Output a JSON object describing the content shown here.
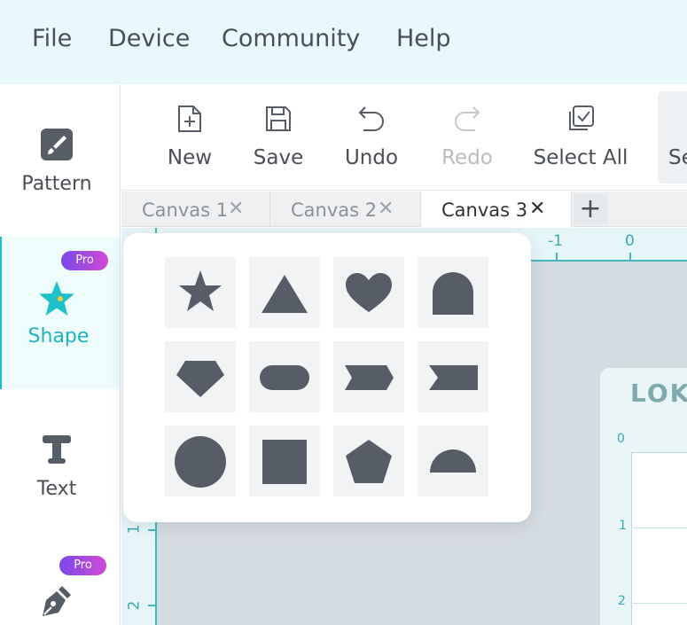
{
  "menu": {
    "file": "File",
    "device": "Device",
    "community": "Community",
    "help": "Help"
  },
  "sidebar": {
    "items": [
      {
        "label": "Pattern",
        "icon": "brush-icon"
      },
      {
        "label": "Shape",
        "icon": "star-icon",
        "badge": "Pro",
        "active": true
      },
      {
        "label": "Text",
        "icon": "text-t-icon"
      },
      {
        "label": "",
        "icon": "pen-nib-icon",
        "badge": "Pro"
      }
    ]
  },
  "toolbar": {
    "new_label": "New",
    "save_label": "Save",
    "undo_label": "Undo",
    "redo_label": "Redo",
    "select_all_label": "Select All",
    "cut_partial_label": "Se"
  },
  "tabs": [
    {
      "label": "Canvas 1",
      "close": "✕"
    },
    {
      "label": "Canvas 2",
      "close": "✕"
    },
    {
      "label": "Canvas 3",
      "close": "✕",
      "active": true
    }
  ],
  "tab_add": "+",
  "ruler": {
    "top_labels": [
      "-1",
      "0"
    ],
    "left_labels": [
      "1",
      "2"
    ]
  },
  "device": {
    "logo": "LOKU",
    "numbers": [
      "0",
      "1",
      "2"
    ]
  },
  "shapes": [
    "star",
    "triangle",
    "heart",
    "arch",
    "diamond",
    "pill",
    "chevron-right",
    "ribbon-banner",
    "circle",
    "square",
    "pentagon",
    "half-circle"
  ],
  "colors": {
    "accent": "#1fc1c8",
    "menubar_bg": "#e8f8fb",
    "shape_fill": "#565d66",
    "pro_badge_start": "#7a48e8",
    "pro_badge_end": "#d14ad6"
  }
}
